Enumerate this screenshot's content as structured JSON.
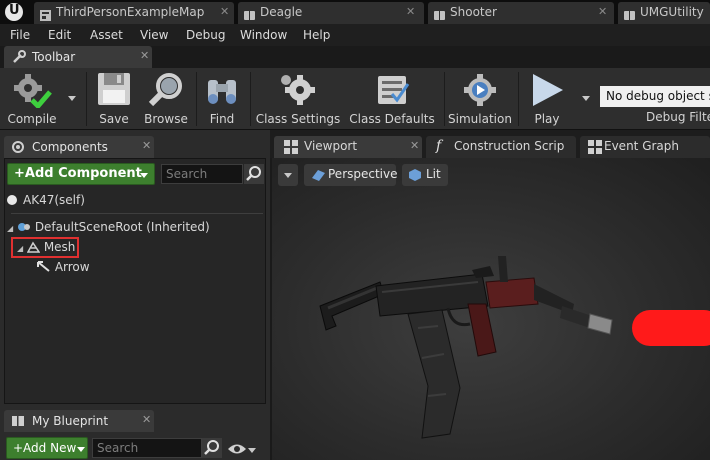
{
  "doc_tabs": [
    {
      "label": "ThirdPersonExampleMap",
      "icon": "map-icon"
    },
    {
      "label": "Deagle",
      "icon": "blueprint-icon"
    },
    {
      "label": "Shooter",
      "icon": "blueprint-icon"
    },
    {
      "label": "UMGUtility",
      "icon": "blueprint-icon"
    }
  ],
  "menu": [
    "File",
    "Edit",
    "Asset",
    "View",
    "Debug",
    "Window",
    "Help"
  ],
  "toolbar_panel": {
    "title": "Toolbar"
  },
  "toolbar": {
    "compile": "Compile",
    "save": "Save",
    "browse": "Browse",
    "find": "Find",
    "class_settings": "Class Settings",
    "class_defaults": "Class Defaults",
    "simulation": "Simulation",
    "play": "Play",
    "debug_object": "No debug object selected",
    "debug_filter": "Debug Filter"
  },
  "components": {
    "title": "Components",
    "add_label": "+Add Component",
    "search_placeholder": "Search",
    "self_item": "AK47(self)",
    "root": "DefaultSceneRoot (Inherited)",
    "mesh": "Mesh",
    "arrow": "Arrow"
  },
  "my_blueprint": {
    "title": "My Blueprint",
    "add_label": "+Add New",
    "search_placeholder": "Search"
  },
  "editor_tabs": {
    "viewport": "Viewport",
    "construction": "Construction Scrip",
    "event_graph": "Event Graph"
  },
  "viewport": {
    "perspective": "Perspective",
    "lit": "Lit"
  },
  "colors": {
    "accent_green": "#3d7f2e",
    "highlight_red": "#e03030",
    "debug_arrow_red": "#ff1a1a"
  }
}
